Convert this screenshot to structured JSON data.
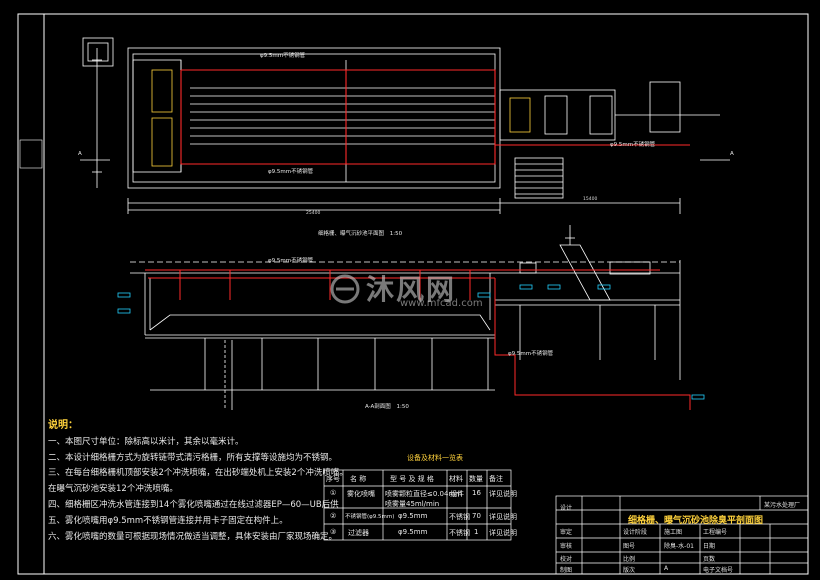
{
  "colors": {
    "background": "#000000",
    "line": "#ffffff",
    "pipe_red": "#ff2a2a",
    "highlight_yellow": "#ffd23c",
    "note_text": "#e8e8e8"
  },
  "plan_view": {
    "top_pipe_label": "φ9.5mm不锈钢管",
    "bottom_pipe_label": "φ9.5mm不锈钢管",
    "right_pipe_label": "φ9.5mm不锈钢管",
    "section_marker_left": "A",
    "section_marker_right": "A",
    "caption": "细格栅、曝气沉砂池平面图",
    "caption_scale": "1:50",
    "dim_total": "25400",
    "dim_right": "15400"
  },
  "section_view": {
    "pipe_label": "φ9.5mm不锈钢管",
    "pipe_label_lower": "φ9.5mm不锈钢管",
    "caption": "A-A剖面图",
    "caption_scale": "1:50"
  },
  "watermark": {
    "text": "沐风网",
    "url": "www.mfcad.com"
  },
  "notes": {
    "title": "说明：",
    "items": [
      "一、本图尺寸单位：除标高以米计，其余以毫米计。",
      "二、本设计细格栅方式为旋转链带式清污格栅，所有支撑等设施均为不锈钢。",
      "三、在每台细格栅机顶部安装2个冲洗喷嘴，在出砂端处机上安装2个冲洗喷嘴。",
      "在曝气沉砂池安装12个冲洗喷嘴。",
      "四、细格栅区冲洗水管连接到14个雾化喷嘴通过在线过滤器EP—60—UB后供",
      "五、雾化喷嘴用φ9.5mm不锈钢管连接并用卡子固定在构件上。",
      "六、雾化喷嘴的数量可根据现场情况做适当调整，具体安装由厂家现场确定。"
    ]
  },
  "equipment_table": {
    "title": "设备及材料一览表",
    "headers": [
      "序号",
      "名  称",
      "型  号  及  规  格",
      "材料",
      "数量",
      "备注"
    ],
    "rows": [
      [
        "①",
        "雾化喷嘴",
        "喷雾颗粒直径≤0.04mm",
        "组件",
        "16",
        "详见说明"
      ],
      [
        "",
        "",
        "喷雾量45ml/min",
        "",
        "",
        ""
      ],
      [
        "②",
        "不锈钢管(φ9.5mm)",
        "φ9.5mm",
        "不锈钢",
        "70",
        "详见说明"
      ],
      [
        "③",
        "过滤器",
        "φ9.5mm",
        "不锈钢",
        "1",
        "详见说明"
      ]
    ]
  },
  "title_block": {
    "company": "某污水处理厂",
    "drawing_title": "细格栅、曝气沉砂池除臭平剖面图",
    "rows": [
      [
        "审定",
        "",
        "设计阶段",
        "施工图",
        "工程编号",
        ""
      ],
      [
        "审核",
        "",
        "图号",
        "除臭-水-01",
        "日期",
        ""
      ],
      [
        "校对",
        "",
        "比例",
        "",
        "页数",
        ""
      ],
      [
        "设计",
        "",
        "",
        "",
        "",
        ""
      ],
      [
        "制图",
        "",
        "版次",
        "A",
        "电子文档号",
        ""
      ]
    ]
  }
}
